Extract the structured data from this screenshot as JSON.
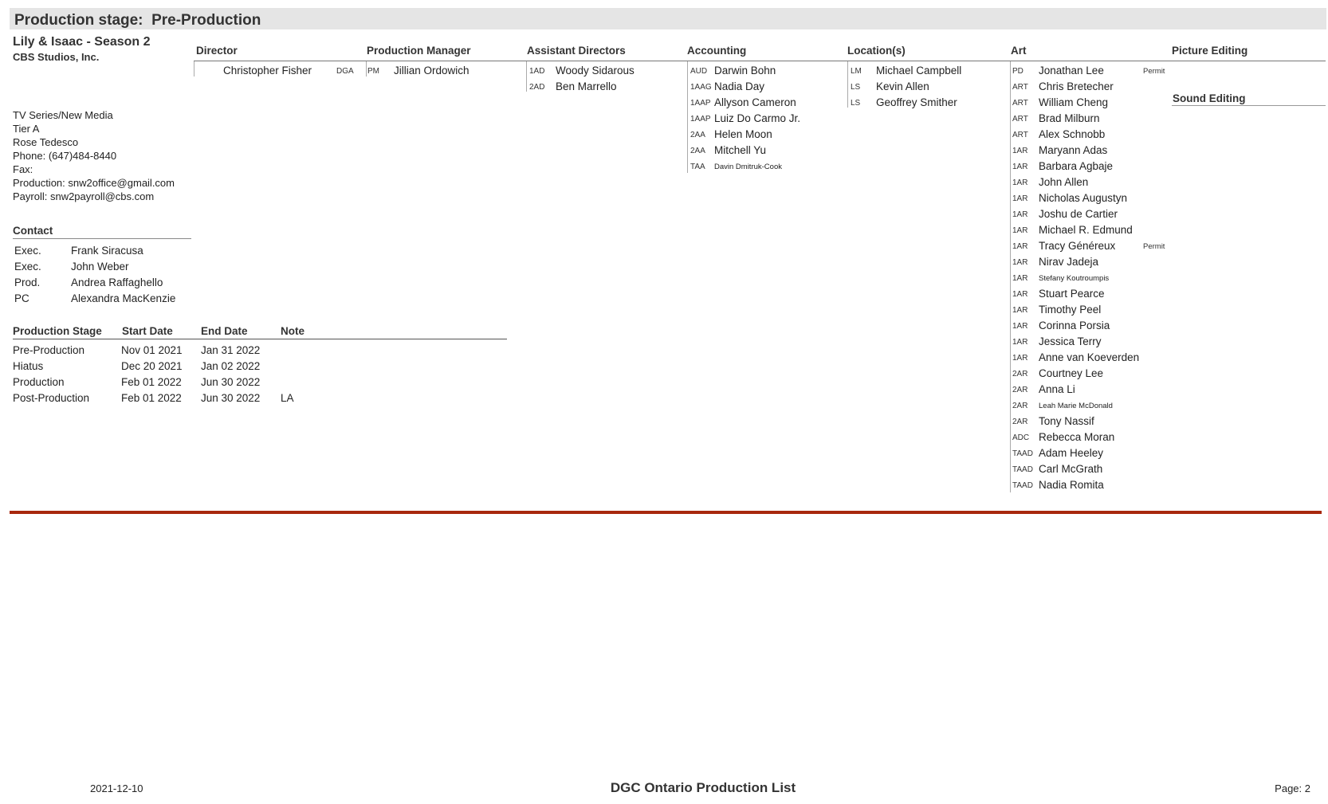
{
  "stage_bar": {
    "label": "Production stage:",
    "stage": "Pre-Production"
  },
  "show": {
    "title": "Lily & Isaac - Season 2",
    "studio": "CBS Studios, Inc."
  },
  "info": [
    "TV Series/New Media",
    "Tier A",
    "Rose Tedesco",
    "Phone: (647)484-8440",
    "Fax:",
    "Production: snw2office@gmail.com",
    "Payroll: snw2payroll@cbs.com"
  ],
  "contact": {
    "heading": "Contact",
    "rows": [
      {
        "role": "Exec.",
        "name": "Frank Siracusa"
      },
      {
        "role": "Exec.",
        "name": "John Weber"
      },
      {
        "role": "Prod.",
        "name": "Andrea Raffaghello"
      },
      {
        "role": "PC",
        "name": "Alexandra MacKenzie"
      }
    ]
  },
  "stages": {
    "headers": [
      "Production Stage",
      "Start Date",
      "End Date",
      "Note"
    ],
    "rows": [
      {
        "stage": "Pre-Production",
        "start": "Nov 01 2021",
        "end": "Jan 31 2022",
        "note": ""
      },
      {
        "stage": "Hiatus",
        "start": "Dec 20 2021",
        "end": "Jan 02 2022",
        "note": ""
      },
      {
        "stage": "Production",
        "start": "Feb 01 2022",
        "end": "Jun 30 2022",
        "note": ""
      },
      {
        "stage": "Post-Production",
        "start": "Feb 01 2022",
        "end": "Jun 30 2022",
        "note": "LA"
      }
    ]
  },
  "director": {
    "heading": "Director",
    "name": "Christopher Fisher",
    "guild": "DGA"
  },
  "production_manager": {
    "heading": "Production Manager",
    "rows": [
      {
        "code": "PM",
        "name": "Jillian Ordowich"
      }
    ]
  },
  "assistant_directors": {
    "heading": "Assistant Directors",
    "rows": [
      {
        "code": "1AD",
        "name": "Woody Sidarous"
      },
      {
        "code": "2AD",
        "name": "Ben Marrello"
      }
    ]
  },
  "accounting": {
    "heading": "Accounting",
    "rows": [
      {
        "code": "AUD",
        "name": "Darwin Bohn"
      },
      {
        "code": "1AAG",
        "name": "Nadia Day"
      },
      {
        "code": "1AAP",
        "name": "Allyson Cameron"
      },
      {
        "code": "1AAP",
        "name": "Luiz Do Carmo Jr."
      },
      {
        "code": "2AA",
        "name": "Helen Moon"
      },
      {
        "code": "2AA",
        "name": "Mitchell Yu"
      },
      {
        "code": "TAA",
        "name": "Davin Dmitruk-Cook",
        "small": true
      }
    ]
  },
  "locations": {
    "heading": "Location(s)",
    "rows": [
      {
        "code": "LM",
        "name": "Michael Campbell"
      },
      {
        "code": "LS",
        "name": "Kevin Allen"
      },
      {
        "code": "LS",
        "name": "Geoffrey Smither"
      }
    ]
  },
  "art": {
    "heading": "Art",
    "rows": [
      {
        "code": "PD",
        "name": "Jonathan Lee",
        "note": "Permit"
      },
      {
        "code": "ART",
        "name": "Chris Bretecher"
      },
      {
        "code": "ART",
        "name": "William Cheng"
      },
      {
        "code": "ART",
        "name": "Brad Milburn"
      },
      {
        "code": "ART",
        "name": "Alex Schnobb"
      },
      {
        "code": "1AR",
        "name": "Maryann Adas"
      },
      {
        "code": "1AR",
        "name": "Barbara Agbaje"
      },
      {
        "code": "1AR",
        "name": "John Allen"
      },
      {
        "code": "1AR",
        "name": "Nicholas Augustyn"
      },
      {
        "code": "1AR",
        "name": "Joshu de Cartier"
      },
      {
        "code": "1AR",
        "name": "Michael R. Edmund"
      },
      {
        "code": "1AR",
        "name": "Tracy Généreux",
        "note": "Permit"
      },
      {
        "code": "1AR",
        "name": "Nirav Jadeja"
      },
      {
        "code": "1AR",
        "name": "Stefany Koutroumpis",
        "small": true
      },
      {
        "code": "1AR",
        "name": "Stuart Pearce"
      },
      {
        "code": "1AR",
        "name": "Timothy Peel"
      },
      {
        "code": "1AR",
        "name": "Corinna Porsia"
      },
      {
        "code": "1AR",
        "name": "Jessica Terry"
      },
      {
        "code": "1AR",
        "name": "Anne van Koeverden"
      },
      {
        "code": "2AR",
        "name": "Courtney Lee"
      },
      {
        "code": "2AR",
        "name": "Anna Li"
      },
      {
        "code": "2AR",
        "name": "Leah Marie McDonald",
        "small": true
      },
      {
        "code": "2AR",
        "name": "Tony Nassif"
      },
      {
        "code": "ADC",
        "name": "Rebecca Moran"
      },
      {
        "code": "TAAD",
        "name": "Adam Heeley"
      },
      {
        "code": "TAAD",
        "name": "Carl McGrath"
      },
      {
        "code": "TAAD",
        "name": "Nadia Romita"
      }
    ]
  },
  "picture_editing": {
    "heading": "Picture Editing"
  },
  "sound_editing": {
    "heading": "Sound Editing"
  },
  "footer": {
    "date": "2021-12-10",
    "title": "DGC Ontario Production List",
    "page": "Page: 2"
  }
}
